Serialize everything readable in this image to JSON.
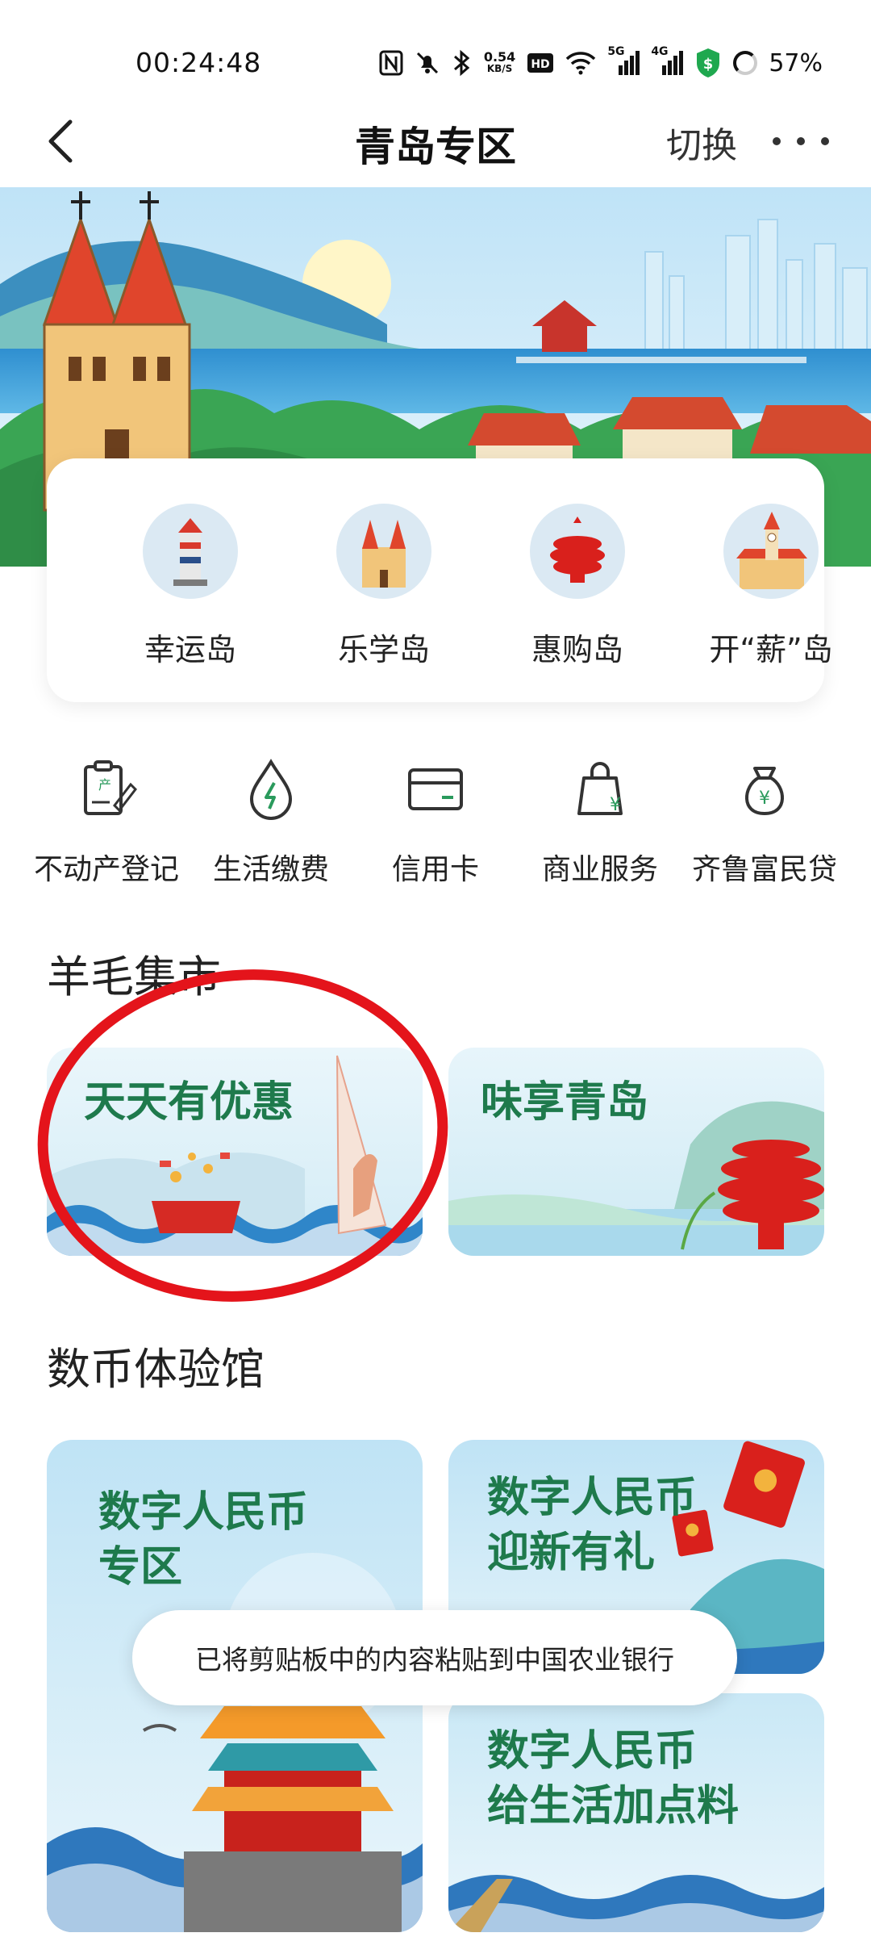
{
  "status_bar": {
    "time": "00:24:48",
    "net_speed_top": "0.54",
    "net_speed_unit": "KB/S",
    "signal_5g": "5G",
    "signal_4g": "4G",
    "battery": "57%"
  },
  "header": {
    "title": "青岛专区",
    "switch_label": "切换"
  },
  "islands": [
    {
      "label": "幸运岛",
      "icon": "lighthouse-icon"
    },
    {
      "label": "乐学岛",
      "icon": "cathedral-icon"
    },
    {
      "label": "惠购岛",
      "icon": "may-wind-sculpture-icon"
    },
    {
      "label": "开“薪”岛",
      "icon": "clock-tower-icon"
    }
  ],
  "services": [
    {
      "label": "不动产登记",
      "icon": "property-registration-icon"
    },
    {
      "label": "生活缴费",
      "icon": "utility-payment-icon"
    },
    {
      "label": "信用卡",
      "icon": "credit-card-icon"
    },
    {
      "label": "商业服务",
      "icon": "shopping-bag-icon"
    },
    {
      "label": "齐鲁富民贷",
      "icon": "money-bag-icon"
    }
  ],
  "sections": {
    "market": "羊毛集市",
    "digital_currency": "数币体验馆"
  },
  "market_cards": [
    {
      "title": "天天有优惠"
    },
    {
      "title": "味享青岛"
    }
  ],
  "digital_cards": [
    {
      "line1": "数字人民币",
      "line2": "专区"
    },
    {
      "line1": "数字人民币",
      "line2": "迎新有礼"
    },
    {
      "line1": "数字人民币",
      "line2": "给生活加点料"
    }
  ],
  "toast": "已将剪贴板中的内容粘贴到中国农业银行",
  "colors": {
    "brand_green": "#1e7a4c",
    "annotation_red": "#e4141b"
  }
}
